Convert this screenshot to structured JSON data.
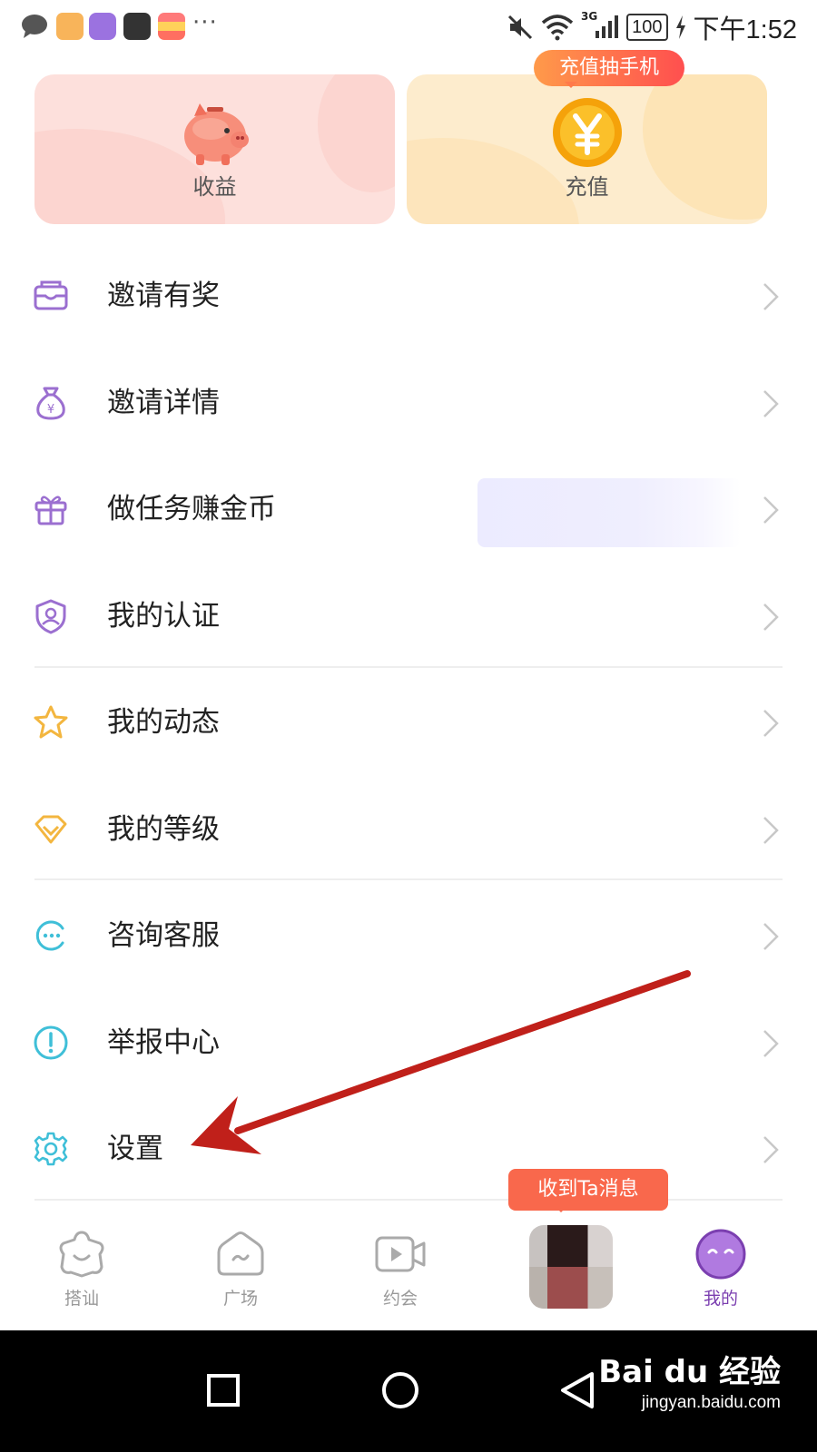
{
  "status_bar": {
    "time": "下午1:52",
    "battery": "100",
    "network": "3G",
    "more_indicator": "···",
    "icons": [
      "message-icon",
      "notes-icon",
      "pie-app-icon",
      "huawei-icon",
      "wallet-icon",
      "mute-icon",
      "wifi-icon",
      "signal-icon",
      "battery-icon",
      "charging-icon"
    ]
  },
  "cards": {
    "income": {
      "label": "收益",
      "icon": "piggy-bank-icon"
    },
    "recharge": {
      "label": "充值",
      "icon": "yuan-coin-icon",
      "promo": "充值抽手机"
    }
  },
  "menu": {
    "items": [
      {
        "label": "邀请有奖",
        "icon": "envelope-icon"
      },
      {
        "label": "邀请详情",
        "icon": "money-bag-icon"
      },
      {
        "label": "做任务赚金币",
        "icon": "gift-box-icon"
      },
      {
        "label": "我的认证",
        "icon": "shield-user-icon"
      },
      {
        "label": "我的动态",
        "icon": "star-icon"
      },
      {
        "label": "我的等级",
        "icon": "diamond-icon"
      },
      {
        "label": "咨询客服",
        "icon": "chat-bubble-icon"
      },
      {
        "label": "举报中心",
        "icon": "alert-icon"
      },
      {
        "label": "设置",
        "icon": "gear-icon"
      }
    ]
  },
  "tabbar": {
    "tabs": [
      {
        "label": "搭讪",
        "icon": "star-face-icon",
        "active": false
      },
      {
        "label": "广场",
        "icon": "house-icon",
        "active": false
      },
      {
        "label": "约会",
        "icon": "video-icon",
        "active": false
      },
      {
        "label": "我的",
        "icon": "smile-face-icon",
        "active": true
      }
    ],
    "message_tip": "收到Ta消息"
  },
  "watermark": {
    "brand": "Bai du 经验",
    "url": "jingyan.baidu.com"
  },
  "colors": {
    "accent_purple": "#7b3fb0",
    "menu_icon_purple": "#9b6fd0",
    "menu_icon_orange": "#f3b63f",
    "menu_icon_teal": "#3fbfd8",
    "promo_red": "#ff4f4f",
    "annotation_red": "#c0201a"
  }
}
